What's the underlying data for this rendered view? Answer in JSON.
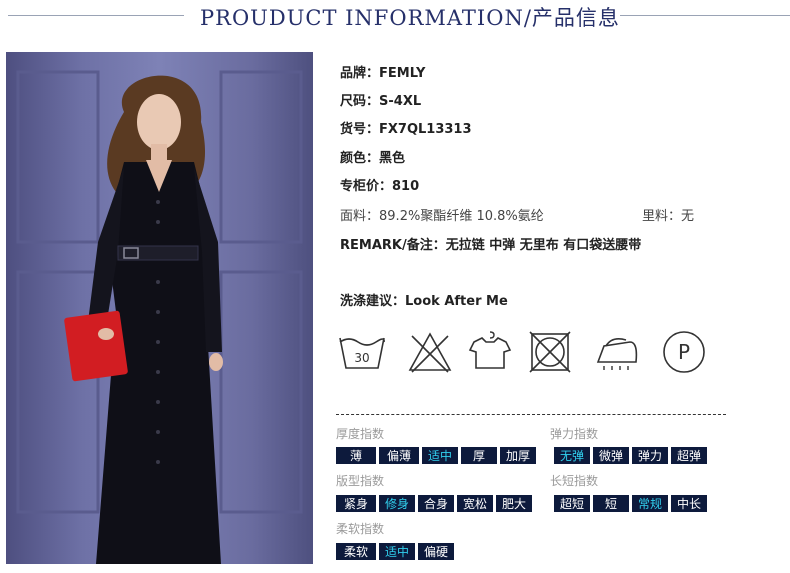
{
  "header": {
    "title": "PROUDUCT INFORMATION/产品信息"
  },
  "product_info": [
    {
      "label": "品牌：",
      "value": "FEMLY"
    },
    {
      "label": "尺码：",
      "value": "S-4XL"
    },
    {
      "label": "货号：",
      "value": "FX7QL13313"
    },
    {
      "label": "颜色：",
      "value": "黑色"
    },
    {
      "label": "专柜价：",
      "value": "810"
    }
  ],
  "fabric": {
    "label": "面料：",
    "value": "89.2%聚酯纤维 10.8%氨纶"
  },
  "lining": {
    "label": "里料：",
    "value": "无"
  },
  "remark": {
    "label": "REMARK/备注：",
    "value": "无拉链 中弹 无里布 有口袋送腰带"
  },
  "wash": {
    "label": "洗涤建议：",
    "value": "Look After Me"
  },
  "care_icons": [
    {
      "name": "wash-30-icon",
      "text": "30"
    },
    {
      "name": "no-bleach-icon"
    },
    {
      "name": "hang-dry-icon"
    },
    {
      "name": "no-tumble-dry-icon"
    },
    {
      "name": "iron-icon"
    },
    {
      "name": "dry-clean-p-icon",
      "text": "P"
    }
  ],
  "indices": {
    "thickness": {
      "title": "厚度指数",
      "options": [
        "薄",
        "偏薄",
        "适中",
        "厚",
        "加厚"
      ],
      "selected": "适中"
    },
    "elasticity": {
      "title": "弹力指数",
      "options": [
        "无弹",
        "微弹",
        "弹力",
        "超弹"
      ],
      "selected": "无弹"
    },
    "fit": {
      "title": "版型指数",
      "options": [
        "紧身",
        "修身",
        "合身",
        "宽松",
        "肥大"
      ],
      "selected": "修身"
    },
    "length": {
      "title": "长短指数",
      "options": [
        "超短",
        "短",
        "常规",
        "中长"
      ],
      "selected": "常规"
    },
    "softness": {
      "title": "柔软指数",
      "options": [
        "柔软",
        "适中",
        "偏硬"
      ],
      "selected": "适中"
    }
  },
  "colors": {
    "header_text": "#26306a",
    "index_bg": "#0d1a3c",
    "index_active": "#31d0ee",
    "photo_bg": "#6e71a6",
    "dress": "#0f0f17",
    "clutch": "#d21d22"
  }
}
